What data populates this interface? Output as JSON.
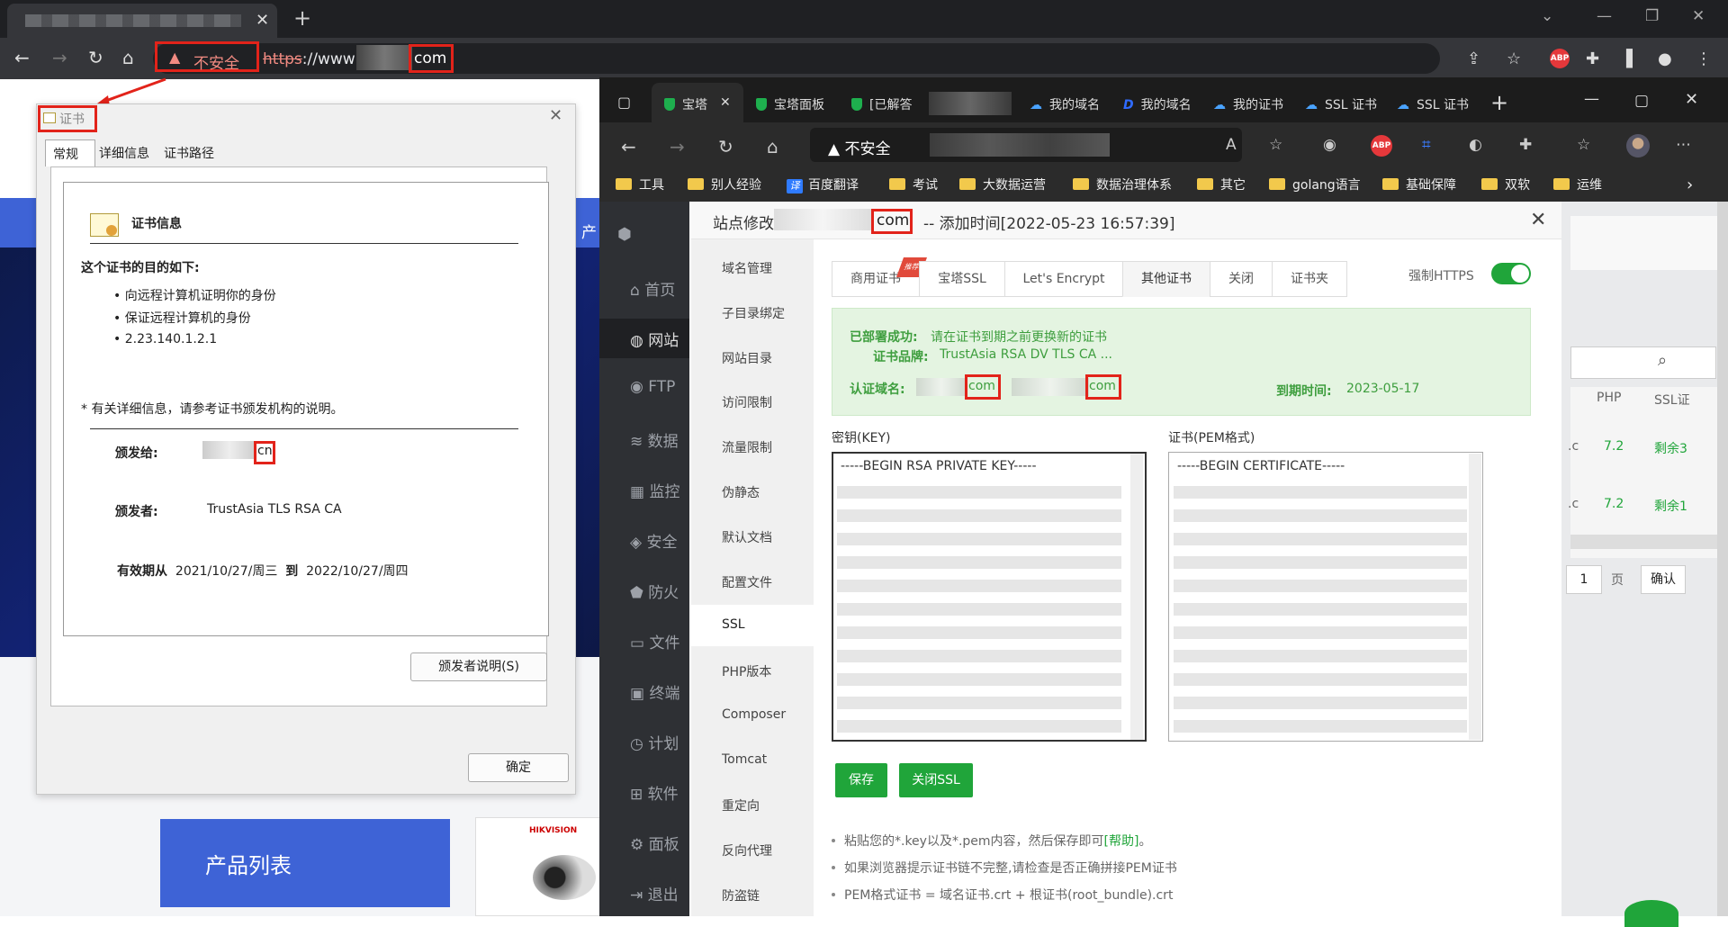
{
  "chrome": {
    "insecure": "不安全",
    "url_scheme": "https",
    "url_prefix": "://www",
    "url_tld": "com"
  },
  "bg_page": {
    "product_list": "产品列表",
    "camera_brand": "HIKVISION"
  },
  "cert": {
    "title": "证书",
    "tabs": [
      "常规",
      "详细信息",
      "证书路径"
    ],
    "info_title": "证书信息",
    "purpose_heading": "这个证书的目的如下:",
    "purposes": [
      "• 向远程计算机证明你的身份",
      "• 保证远程计算机的身份",
      "• 2.23.140.1.2.1"
    ],
    "note": "* 有关详细信息，请参考证书颁发机构的说明。",
    "issued_to_label": "颁发给:",
    "issued_to_tld": "cn",
    "issuer_label": "颁发者:",
    "issuer": "TrustAsia TLS RSA CA",
    "valid_from_label": "有效期从",
    "valid_from": "2021/10/27/周三",
    "valid_to_label": "到",
    "valid_to": "2022/10/27/周四",
    "issuer_statement_button": "颁发者说明(S)",
    "ok_button": "确定"
  },
  "edge": {
    "tabs": [
      "宝塔",
      "宝塔面板",
      "[已解答",
      "我的域名",
      "我的域名",
      "我的证书",
      "SSL 证书",
      "SSL 证书"
    ],
    "insecure": "不安全",
    "bookmarks": [
      "工具",
      "别人经验",
      "百度翻译",
      "考试",
      "大数据运营",
      "数据治理体系",
      "其它",
      "golang语言",
      "基础保障",
      "双软",
      "运维"
    ],
    "bookmark_translate_glyph": "译"
  },
  "bt": {
    "sidebar": [
      "首页",
      "网站",
      "FTP",
      "数据",
      "监控",
      "安全",
      "防火",
      "文件",
      "终端",
      "计划",
      "软件",
      "面板",
      "退出"
    ],
    "sidebar_text": "产",
    "right_col_php": "PHP",
    "right_col_ssl": "SSL证",
    "right_rows": [
      {
        "php": "7.2",
        "ssl": "剩余3"
      },
      {
        "php": "7.2",
        "ssl": "剩余1"
      }
    ],
    "right_row_prefix": ".c",
    "page_num": "1",
    "page_label": "页",
    "confirm": "确认"
  },
  "modal": {
    "title_prefix": "站点修改",
    "title_tld": "com",
    "title_suffix": "-- 添加时间[2022-05-23 16:57:39]",
    "nav": [
      "域名管理",
      "子目录绑定",
      "网站目录",
      "访问限制",
      "流量限制",
      "伪静态",
      "默认文档",
      "配置文件",
      "SSL",
      "PHP版本",
      "Composer",
      "Tomcat",
      "重定向",
      "反向代理",
      "防盗链"
    ],
    "tabs": [
      "商用证书",
      "宝塔SSL",
      "Let's Encrypt",
      "其他证书",
      "关闭",
      "证书夹"
    ],
    "tab_badge": "推荐",
    "force_https": "强制HTTPS",
    "deployed_label": "已部署成功:",
    "deployed_text": "请在证书到期之前更换新的证书",
    "brand_label": "证书品牌:",
    "brand": "TrustAsia RSA DV TLS CA ...",
    "domains_label": "认证域名:",
    "domain_tld_1": "com",
    "domain_tld_2": "com",
    "expire_label": "到期时间:",
    "expire_date": "2023-05-17",
    "key_label": "密钥(KEY)",
    "cert_label": "证书(PEM格式)",
    "key_head": "-----BEGIN RSA PRIVATE KEY-----",
    "cert_head": "-----BEGIN CERTIFICATE-----",
    "save": "保存",
    "close_ssl": "关闭SSL",
    "tip1_a": "粘贴您的*.key以及*.pem内容，然后保存即可",
    "tip1_link": "[帮助]",
    "tip1_b": "。",
    "tip2": "如果浏览器提示证书链不完整,请检查是否正确拼接PEM证书",
    "tip3": "PEM格式证书 = 域名证书.crt + 根证书(root_bundle).crt"
  },
  "colors": {
    "accent_green": "#20a53a",
    "annotation_red": "#e2231a",
    "brand_blue": "#3e63d6"
  }
}
